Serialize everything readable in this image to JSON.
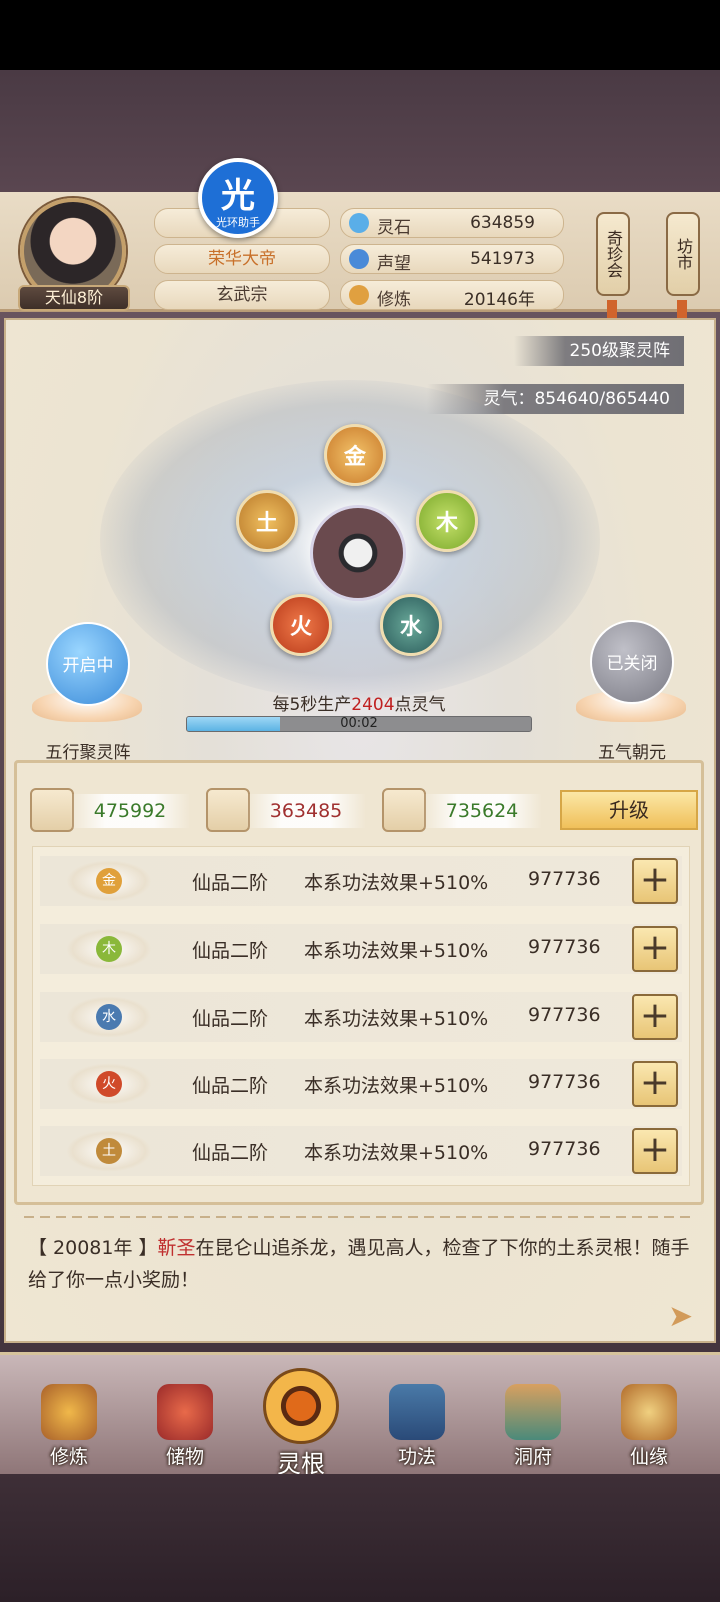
{
  "header": {
    "rank": "天仙8阶",
    "aura_badge": {
      "glyph": "光",
      "text": "光环助手"
    },
    "title_name": "荣华大帝",
    "sect": "玄武宗",
    "stats": [
      {
        "icon": "spirit-stone-icon",
        "label": "灵石",
        "value": "634859"
      },
      {
        "icon": "reputation-icon",
        "label": "声望",
        "value": "541973"
      },
      {
        "icon": "cultivation-icon",
        "label": "修炼",
        "value": "20146年"
      }
    ],
    "scroll_buttons": [
      {
        "label": "奇珍会"
      },
      {
        "label": "坊市"
      }
    ]
  },
  "array": {
    "level_banner": "250级聚灵阵",
    "qi_banner": "灵气：854640/865440",
    "elements": {
      "metal": "金",
      "wood": "木",
      "water": "水",
      "fire": "火",
      "earth": "土"
    },
    "left_orb": {
      "state": "开启中",
      "label": "五行聚灵阵"
    },
    "right_orb": {
      "state": "已关闭",
      "label": "五气朝元"
    },
    "produce_prefix": "每5秒生产",
    "produce_amount": "2404",
    "produce_suffix": "点灵气",
    "timer": "00:02",
    "progress": 0.27
  },
  "resources": [
    {
      "icon": "book-icon",
      "value": "475992",
      "color": "#3a7a2a"
    },
    {
      "icon": "wood-log-icon",
      "value": "363485",
      "color": "#a03030"
    },
    {
      "icon": "herb-icon",
      "value": "735624",
      "color": "#3a7a2a"
    }
  ],
  "upgrade_label": "升级",
  "roots": [
    {
      "element": "金",
      "color": "#e0a03a",
      "grade": "仙品二阶",
      "effect": "本系功法效果+510%",
      "value": "977736"
    },
    {
      "element": "木",
      "color": "#8ab83a",
      "grade": "仙品二阶",
      "effect": "本系功法效果+510%",
      "value": "977736"
    },
    {
      "element": "水",
      "color": "#4a7ab0",
      "grade": "仙品二阶",
      "effect": "本系功法效果+510%",
      "value": "977736"
    },
    {
      "element": "火",
      "color": "#d04a2a",
      "grade": "仙品二阶",
      "effect": "本系功法效果+510%",
      "value": "977736"
    },
    {
      "element": "土",
      "color": "#c08a3a",
      "grade": "仙品二阶",
      "effect": "本系功法效果+510%",
      "value": "977736"
    }
  ],
  "log": {
    "year": "【 20081年 】",
    "who": "靳圣",
    "text": "在昆仑山追杀龙，遇见高人，检查了下你的土系灵根！随手给了你一点小奖励！"
  },
  "nav": [
    {
      "label": "修炼",
      "icon": "cultivate-icon"
    },
    {
      "label": "储物",
      "icon": "storage-bag-icon"
    },
    {
      "label": "灵根",
      "icon": "spirit-root-icon",
      "active": true
    },
    {
      "label": "功法",
      "icon": "technique-book-icon"
    },
    {
      "label": "洞府",
      "icon": "cave-mansion-icon"
    },
    {
      "label": "仙缘",
      "icon": "immortal-fate-icon"
    }
  ]
}
